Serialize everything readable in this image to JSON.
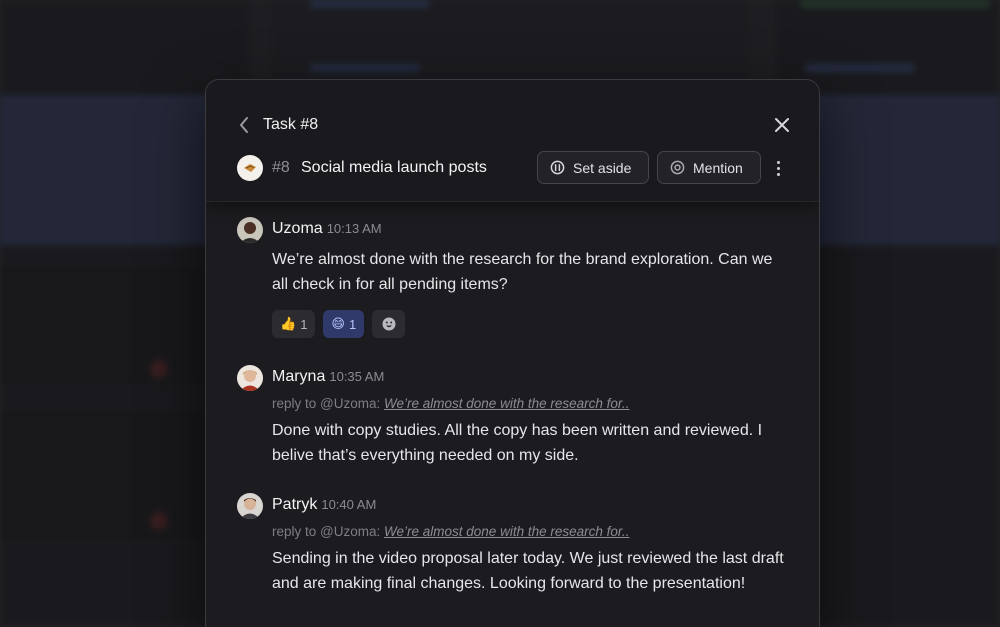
{
  "modal": {
    "title": "Task #8",
    "task": {
      "number": "#8",
      "name": "Social media launch posts"
    },
    "actions": {
      "set_aside": "Set aside",
      "mention": "Mention"
    }
  },
  "messages": [
    {
      "author": "Uzoma",
      "time": "10:13 AM",
      "text": "We’re almost done with the research for the brand exploration. Can we all check  in for all pending items?",
      "reactions": [
        {
          "emoji": "👍",
          "count": "1",
          "active": false
        },
        {
          "emoji": "😄",
          "count": "1",
          "active": true
        }
      ]
    },
    {
      "author": "Maryna",
      "time": "10:35 AM",
      "reply_prefix": "reply to @Uzoma:",
      "reply_quote": "We’re almost done with the research for..",
      "text": "Done with copy studies. All the copy has been written and reviewed. I belive that’s everything needed on my side."
    },
    {
      "author": "Patryk",
      "time": "10:40 AM",
      "reply_prefix": "reply to @Uzoma:",
      "reply_quote": "We’re almost done with the research for..",
      "text": "Sending in the video proposal later today. We just reviewed the last draft and are making final changes. Looking forward to the presentation!"
    }
  ],
  "icons": {
    "back": "chevron-left-icon",
    "close": "close-icon",
    "set_aside": "pause-circle-icon",
    "mention": "at-sign-icon",
    "more": "more-vertical-icon",
    "add_reaction": "add-emoji-icon"
  },
  "colors": {
    "modal_bg": "#1c1c20",
    "active_reaction": "#2f3a6a",
    "background_band": "#2c3350"
  }
}
